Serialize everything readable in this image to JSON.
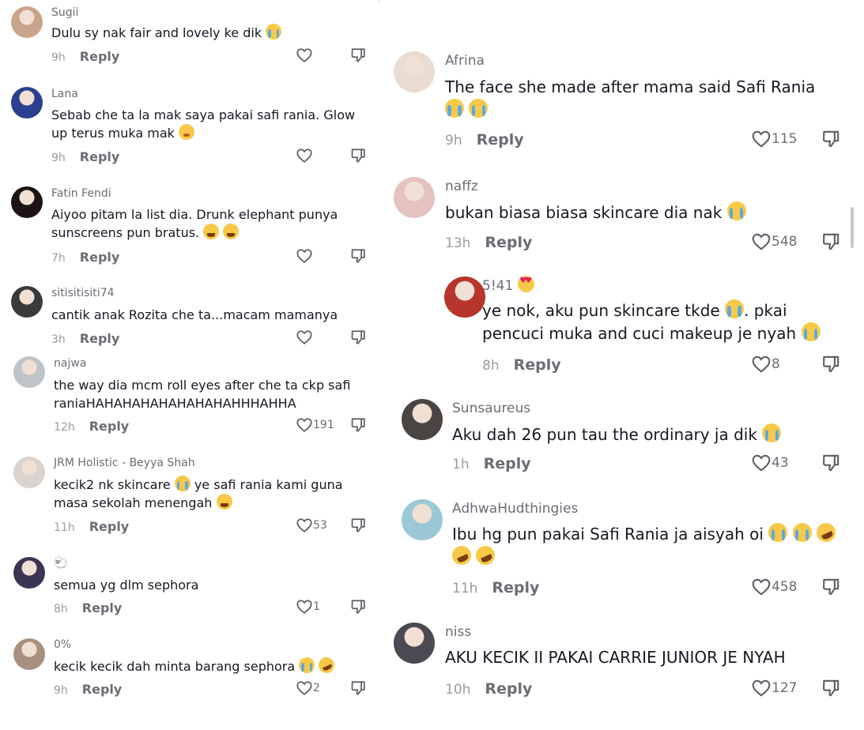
{
  "left_comments": [
    {
      "user": "Sugii",
      "text": "Dulu sy nak fair and lovely ke dik",
      "emoji_after": [
        "cry"
      ],
      "time": "9h",
      "likes": "",
      "avatar_color": "#c9a48a"
    },
    {
      "user": "Lana",
      "text": "Sebab che ta la mak saya pakai safi rania. Glow up terus muka mak",
      "emoji_after": [
        "blush"
      ],
      "time": "9h",
      "likes": "",
      "avatar_color": "#2a3f8f"
    },
    {
      "user": "Fatin Fendi",
      "text": "Aiyoo pitam la list dia. Drunk elephant punya sunscreens pun bratus.",
      "emoji_after": [
        "laugh",
        "laugh"
      ],
      "time": "7h",
      "likes": "",
      "avatar_color": "#1c1414"
    },
    {
      "user": "sitisitisiti74",
      "text": "cantik anak Rozita che ta...macam mamanya",
      "emoji_after": [],
      "time": "3h",
      "likes": "",
      "avatar_color": "#3a3a3a"
    },
    {
      "user": "najwa",
      "text": "the way dia mcm roll eyes after che ta ckp safi raniaHAHAHAHAHAHAHAHAHHHAHHA",
      "emoji_after": [],
      "time": "12h",
      "likes": "191",
      "avatar_color": "#bfc4c9"
    },
    {
      "user": "JRM Holistic - Beyya Shah",
      "text": "kecik2 nk skincare [cry] ye safi rania kami guna masa sekolah menengah",
      "emoji_after": [
        "laugh"
      ],
      "time": "11h",
      "likes": "53",
      "avatar_color": "#d9d4cf"
    },
    {
      "user": "🐑",
      "text": "semua yg dlm sephora",
      "emoji_after": [],
      "time": "8h",
      "likes": "1",
      "avatar_color": "#3b3552"
    },
    {
      "user": "0%",
      "text": "kecik kecik dah minta barang sephora",
      "emoji_after": [
        "cry",
        "rofl"
      ],
      "time": "9h",
      "likes": "2",
      "avatar_color": "#a89080"
    }
  ],
  "right_comments": [
    {
      "user": "Afrina",
      "text": "The face she made after mama said Safi Rania",
      "emoji_after": [
        "cry",
        "cry"
      ],
      "time": "9h",
      "likes": "115",
      "avatar_color": "#e9dcd0"
    },
    {
      "user": "naffz",
      "text": "bukan biasa biasa skincare dia nak",
      "emoji_after": [
        "cry"
      ],
      "time": "13h",
      "likes": "548",
      "avatar_color": "#e3c2c0"
    },
    {
      "user": "5!41",
      "text": "ye nok, aku pun skincare tkde [cry]. pkai pencuci muka and cuci makeup je nyah",
      "emoji_after": [
        "cry"
      ],
      "time": "8h",
      "likes": "8",
      "avatar_color": "#b7352b",
      "name_emoji": "love"
    },
    {
      "user": "Sunsaureus",
      "text": "Aku dah 26 pun tau the ordinary ja dik",
      "emoji_after": [
        "cry"
      ],
      "time": "1h",
      "likes": "43",
      "avatar_color": "#4a4542"
    },
    {
      "user": "AdhwaHudthingies",
      "text": "Ibu hg pun pakai Safi Rania ja aisyah oi",
      "emoji_after": [
        "cry",
        "cry",
        "rofl",
        "rofl",
        "rofl"
      ],
      "time": "11h",
      "likes": "458",
      "avatar_color": "#9cc7d6"
    },
    {
      "user": "niss",
      "text": "AKU KECIK II PAKAI CARRIE JUNIOR JE NYAH",
      "emoji_after": [],
      "time": "10h",
      "likes": "127",
      "avatar_color": "#4b4a52"
    }
  ],
  "reply_label": "Reply",
  "icons": {
    "like": "heart-outline-icon",
    "dislike": "thumbs-down-icon"
  }
}
